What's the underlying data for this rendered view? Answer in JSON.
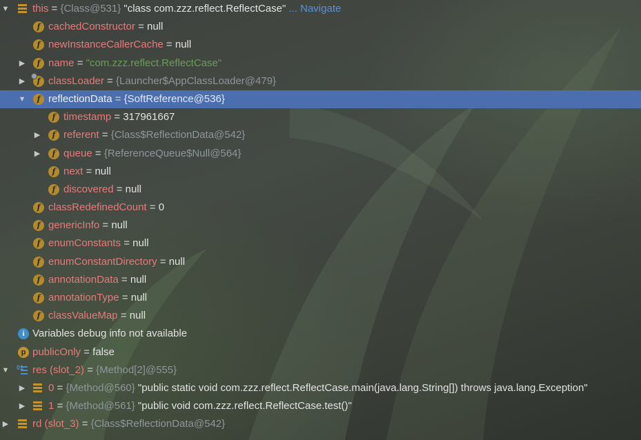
{
  "root": {
    "arrow": "▼",
    "name": "this",
    "eq": " = ",
    "ref": "{Class@531}",
    "value": " \"class com.zzz.reflect.ReflectCase\"",
    "navigate": " ... Navigate"
  },
  "fields": {
    "cachedConstructor": {
      "name": "cachedConstructor",
      "eq": " = ",
      "value": "null"
    },
    "newInstanceCallerCache": {
      "name": "newInstanceCallerCache",
      "eq": " = ",
      "value": "null"
    },
    "name": {
      "arrow": "▶",
      "name": "name",
      "eq": " = ",
      "str": "\"com.zzz.reflect.ReflectCase\""
    },
    "classLoader": {
      "arrow": "▶",
      "name": "classLoader",
      "eq": " = ",
      "ref": "{Launcher$AppClassLoader@479}"
    },
    "reflectionData": {
      "arrow": "▼",
      "name": "reflectionData",
      "eq": " = ",
      "ref": "{SoftReference@536}"
    },
    "timestamp": {
      "name": "timestamp",
      "eq": " = ",
      "value": "317961667"
    },
    "referent": {
      "arrow": "▶",
      "name": "referent",
      "eq": " = ",
      "ref": "{Class$ReflectionData@542}"
    },
    "queue": {
      "arrow": "▶",
      "name": "queue",
      "eq": " = ",
      "ref": "{ReferenceQueue$Null@564}"
    },
    "next": {
      "name": "next",
      "eq": " = ",
      "value": "null"
    },
    "discovered": {
      "name": "discovered",
      "eq": " = ",
      "value": "null"
    },
    "classRedefinedCount": {
      "name": "classRedefinedCount",
      "eq": " = ",
      "value": "0"
    },
    "genericInfo": {
      "name": "genericInfo",
      "eq": " = ",
      "value": "null"
    },
    "enumConstants": {
      "name": "enumConstants",
      "eq": " = ",
      "value": "null"
    },
    "enumConstantDirectory": {
      "name": "enumConstantDirectory",
      "eq": " = ",
      "value": "null"
    },
    "annotationData": {
      "name": "annotationData",
      "eq": " = ",
      "value": "null"
    },
    "annotationType": {
      "name": "annotationType",
      "eq": " = ",
      "value": "null"
    },
    "classValueMap": {
      "name": "classValueMap",
      "eq": " = ",
      "value": "null"
    }
  },
  "info": {
    "text": "Variables debug info not available"
  },
  "publicOnly": {
    "name": "publicOnly",
    "eq": " = ",
    "value": "false"
  },
  "res": {
    "arrow": "▼",
    "name": "res (slot_2)",
    "eq": " = ",
    "ref": "{Method[2]@555}",
    "items": [
      {
        "arrow": "▶",
        "index": "0",
        "eq": " = ",
        "ref": "{Method@560}",
        "value": " \"public static void com.zzz.reflect.ReflectCase.main(java.lang.String[]) throws java.lang.Exception\""
      },
      {
        "arrow": "▶",
        "index": "1",
        "eq": " = ",
        "ref": "{Method@561}",
        "value": " \"public void com.zzz.reflect.ReflectCase.test()\""
      }
    ]
  },
  "rd": {
    "arrow": "▶",
    "name": "rd (slot_3)",
    "eq": " = ",
    "ref": "{Class$ReflectionData@542}"
  },
  "icons": {
    "field": "f",
    "param": "p",
    "info": "i"
  },
  "colors": {
    "selection": "#4b6eaf",
    "field_name": "#e8797a",
    "reference": "#8f969b",
    "string": "#6c9c5a",
    "navigate": "#5c90d4",
    "field_icon": "#b38a2c"
  }
}
